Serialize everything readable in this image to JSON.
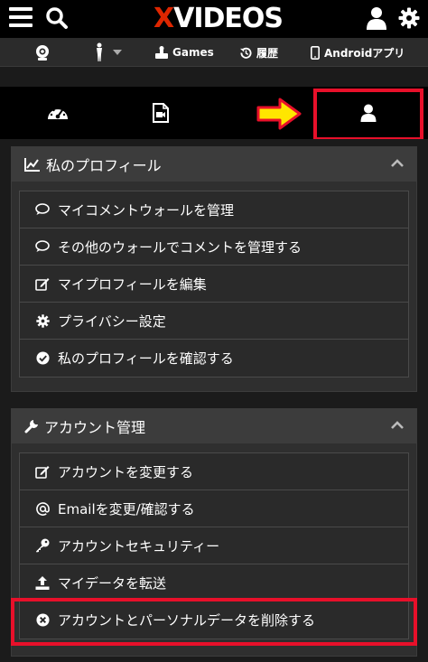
{
  "header": {
    "logo_x": "X",
    "logo_rest": "VIDEOS",
    "icons": [
      "hamburger-icon",
      "search-icon",
      "user-icon",
      "gear-icon"
    ]
  },
  "subnav": {
    "items": [
      {
        "icon": "webcam-icon",
        "label": ""
      },
      {
        "icon": "female-figure-icon",
        "label": ""
      },
      {
        "icon": "games-icon",
        "label": "Games"
      },
      {
        "icon": "history-icon",
        "label": "履歴"
      },
      {
        "icon": "mobile-icon",
        "label": "Androidアプリ"
      }
    ]
  },
  "tabs": [
    {
      "icon": "dashboard-icon"
    },
    {
      "icon": "video-file-icon"
    },
    {
      "icon": "profile-user-icon",
      "active": true
    }
  ],
  "profile_panel": {
    "title": "私のプロフィール",
    "items": [
      {
        "icon": "comment-icon",
        "label": "マイコメントウォールを管理"
      },
      {
        "icon": "comment-icon",
        "label": "その他のウォールでコメントを管理する"
      },
      {
        "icon": "edit-icon",
        "label": "マイプロフィールを編集"
      },
      {
        "icon": "gear-icon",
        "label": "プライバシー設定"
      },
      {
        "icon": "check-circle-icon",
        "label": "私のプロフィールを確認する"
      }
    ]
  },
  "account_panel": {
    "title": "アカウント管理",
    "items": [
      {
        "icon": "edit-icon",
        "label": "アカウントを変更する"
      },
      {
        "icon": "at-icon",
        "label": "Emailを変更/確認する"
      },
      {
        "icon": "key-icon",
        "label": "アカウントセキュリティー"
      },
      {
        "icon": "upload-icon",
        "label": "マイデータを転送"
      },
      {
        "icon": "close-circle-icon",
        "label": "アカウントとパーソナルデータを削除する"
      }
    ]
  },
  "colors": {
    "highlight_red": "#e8102a",
    "arrow_yellow": "#ffe600",
    "logo_red": "#de2600"
  }
}
